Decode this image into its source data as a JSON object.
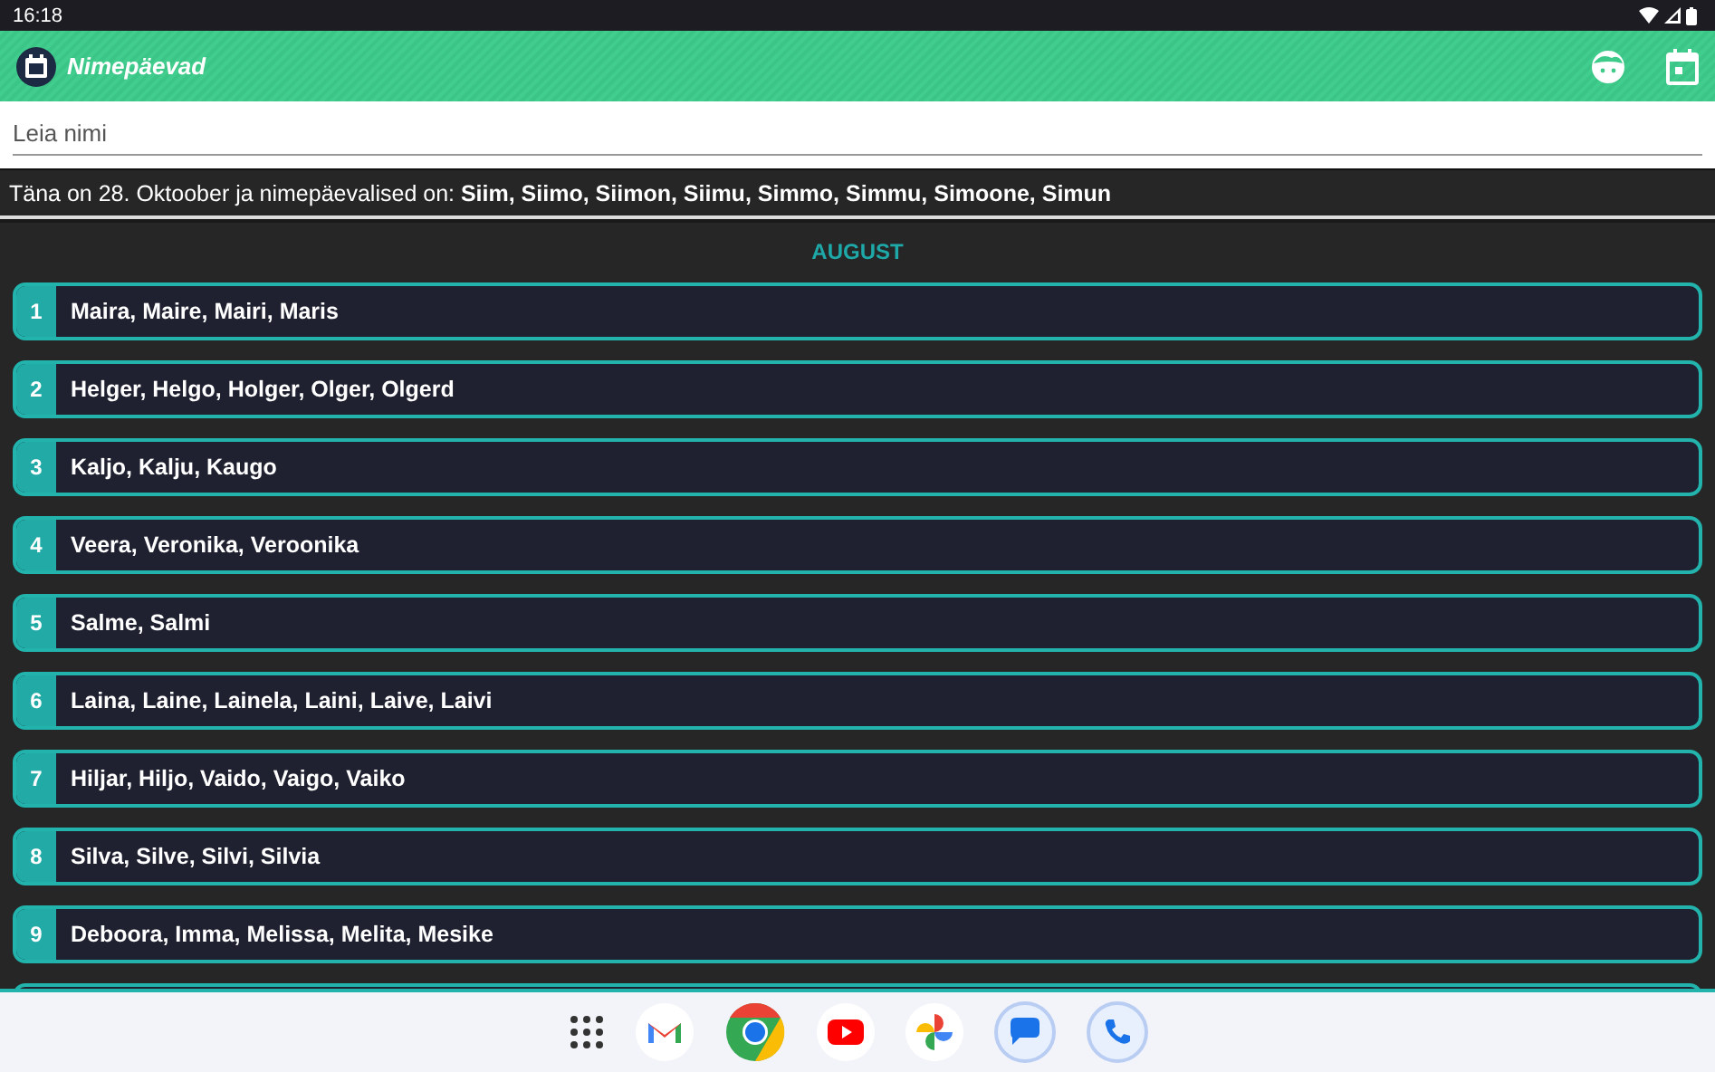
{
  "status_bar": {
    "time": "16:18"
  },
  "app_bar": {
    "title": "Nimepäevad"
  },
  "search": {
    "placeholder": "Leia nimi"
  },
  "today": {
    "text": "Täna on 28. Oktoober ja nimepäevalised on: **Siim, Siimo, Siimon, Siimu, Simmo, Simmu, Simoone, Simun**"
  },
  "month": "AUGUST",
  "days": [
    {
      "day": "1",
      "names": "Maira, Maire, Mairi, Maris"
    },
    {
      "day": "2",
      "names": "Helger, Helgo, Holger, Olger, Olgerd"
    },
    {
      "day": "3",
      "names": "Kaljo, Kalju, Kaugo"
    },
    {
      "day": "4",
      "names": "Veera, Veronika, Veroonika"
    },
    {
      "day": "5",
      "names": "Salme, Salmi"
    },
    {
      "day": "6",
      "names": "Laina, Laine, Lainela, Laini, Laive, Laivi"
    },
    {
      "day": "7",
      "names": "Hiljar, Hiljo, Vaido, Vaigo, Vaiko"
    },
    {
      "day": "8",
      "names": "Silva, Silve, Silvi, Silvia"
    },
    {
      "day": "9",
      "names": "Deboora, Imma, Melissa, Melita, Mesike"
    }
  ]
}
